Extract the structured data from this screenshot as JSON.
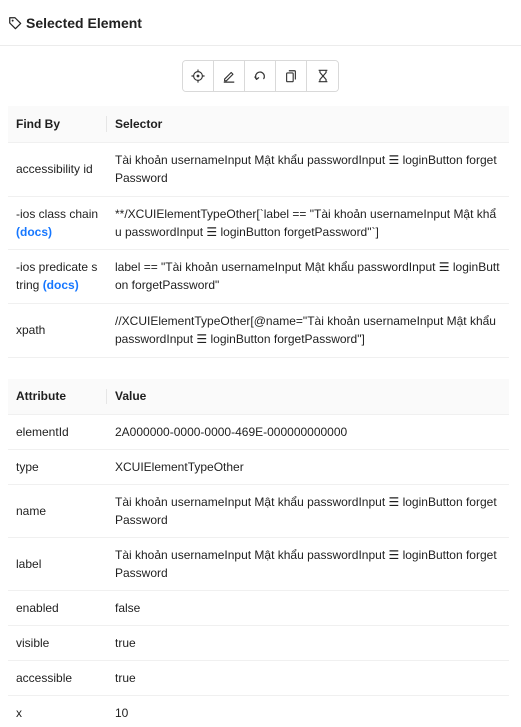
{
  "header": {
    "title": "Selected Element",
    "icon": "tag-icon"
  },
  "toolbar": {
    "buttons": [
      {
        "name": "tap-element-button",
        "icon": "crosshair-icon"
      },
      {
        "name": "send-keys-button",
        "icon": "pencil-icon"
      },
      {
        "name": "clear-button",
        "icon": "refresh-icon"
      },
      {
        "name": "copy-attributes-button",
        "icon": "copy-icon"
      },
      {
        "name": "get-timing-button",
        "icon": "hourglass-icon"
      }
    ]
  },
  "selectors": {
    "header_find_by": "Find By",
    "header_selector": "Selector",
    "docs_label": "(docs)",
    "rows": [
      {
        "find_by": "accessibility id",
        "selector": "Tài khoản usernameInput Mật khẩu passwordInput ☰ loginButton forgetPassword"
      },
      {
        "find_by": "-ios class chain",
        "selector": "**/XCUIElementTypeOther[`label == \"Tài khoản usernameInput Mật khẩu passwordInput ☰ loginButton forgetPassword\"`]"
      },
      {
        "find_by": "-ios predicate string",
        "selector": "label == \"Tài khoản usernameInput Mật khẩu passwordInput ☰ loginButton forgetPassword\""
      },
      {
        "find_by": "xpath",
        "selector": "//XCUIElementTypeOther[@name=\"Tài khoản usernameInput Mật khẩu passwordInput ☰ loginButton forgetPassword\"]"
      }
    ]
  },
  "attributes": {
    "header_attribute": "Attribute",
    "header_value": "Value",
    "rows": [
      {
        "name": "elementId",
        "value": "2A000000-0000-0000-469E-000000000000"
      },
      {
        "name": "type",
        "value": "XCUIElementTypeOther"
      },
      {
        "name": "name",
        "value": "Tài khoản usernameInput Mật khẩu passwordInput ☰ loginButton forgetPassword"
      },
      {
        "name": "label",
        "value": "Tài khoản usernameInput Mật khẩu passwordInput ☰ loginButton forgetPassword"
      },
      {
        "name": "enabled",
        "value": "false"
      },
      {
        "name": "visible",
        "value": "true"
      },
      {
        "name": "accessible",
        "value": "true"
      },
      {
        "name": "x",
        "value": "10"
      }
    ]
  },
  "colors": {
    "link": "#1677ff",
    "border": "#f0f0f0",
    "header_bg": "#fafafa"
  }
}
